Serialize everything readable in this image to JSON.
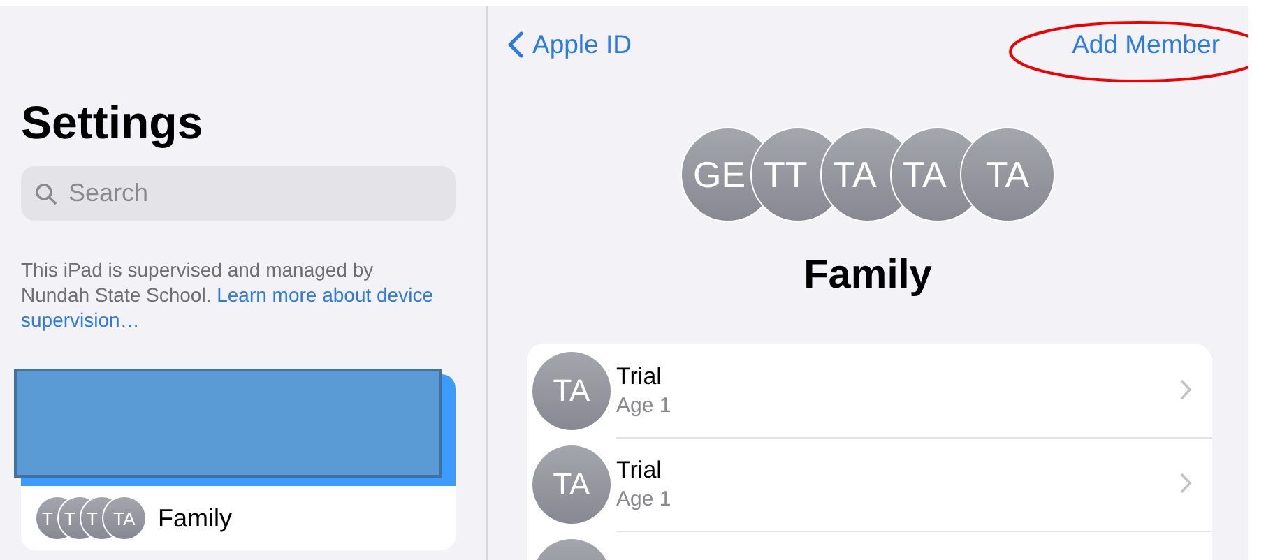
{
  "sidebar": {
    "title": "Settings",
    "search": {
      "placeholder": "Search"
    },
    "supervision_note": "This iPad is supervised and managed by Nundah State School. **Learn more about device supervision…**",
    "account_card": {
      "family_row": {
        "avatars": [
          "T",
          "T",
          "T",
          "TA"
        ],
        "label": "Family"
      }
    }
  },
  "detail": {
    "back_button": "Apple ID",
    "add_member_button": "Add Member",
    "group_avatars": [
      "GE",
      "TT",
      "TA",
      "TA",
      "TA"
    ],
    "title": "Family",
    "members": [
      {
        "initials": "TA",
        "name": "Trial",
        "age": "Age 1"
      },
      {
        "initials": "TA",
        "name": "Trial",
        "age": "Age 1"
      }
    ]
  }
}
